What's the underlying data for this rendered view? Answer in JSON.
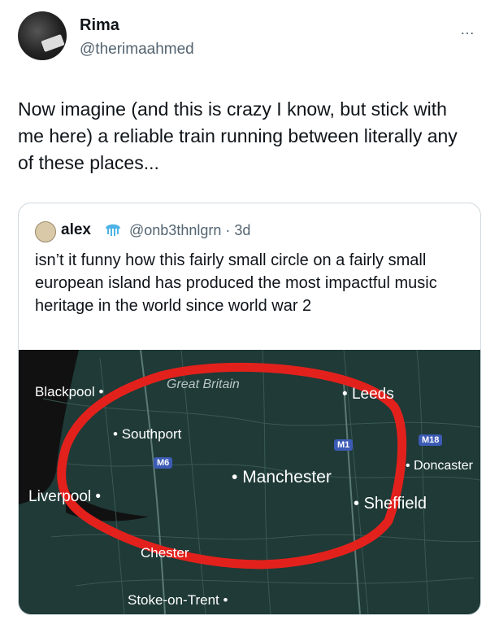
{
  "tweet": {
    "author_name": "Rima",
    "author_handle": "@therimaahmed",
    "more_icon": "…",
    "text": "Now imagine (and this is crazy I know, but stick with me here) a reliable train running between literally any of these places..."
  },
  "quoted": {
    "author_name": "alex",
    "author_handle": "@onb3thnlgrn",
    "separator": "·",
    "age": "3d",
    "text": "isn’t it funny how this fairly small circle on a fairly small european island has produced the most impactful music heritage in the world since world war 2"
  },
  "map": {
    "region_label": "Great Britain",
    "cities": {
      "blackpool": "Blackpool",
      "southport": "Southport",
      "liverpool": "Liverpool",
      "manchester": "Manchester",
      "leeds": "Leeds",
      "sheffield": "Sheffield",
      "doncaster": "Doncaster",
      "chester": "Chester",
      "stoke": "Stoke-on-Trent"
    },
    "roads": {
      "m6": "M6",
      "m1": "M1",
      "m18": "M18"
    },
    "colors": {
      "land": "#1f3a37",
      "sea": "#111111",
      "circle": "#e3211c",
      "shield": "#3c5bb5"
    }
  }
}
